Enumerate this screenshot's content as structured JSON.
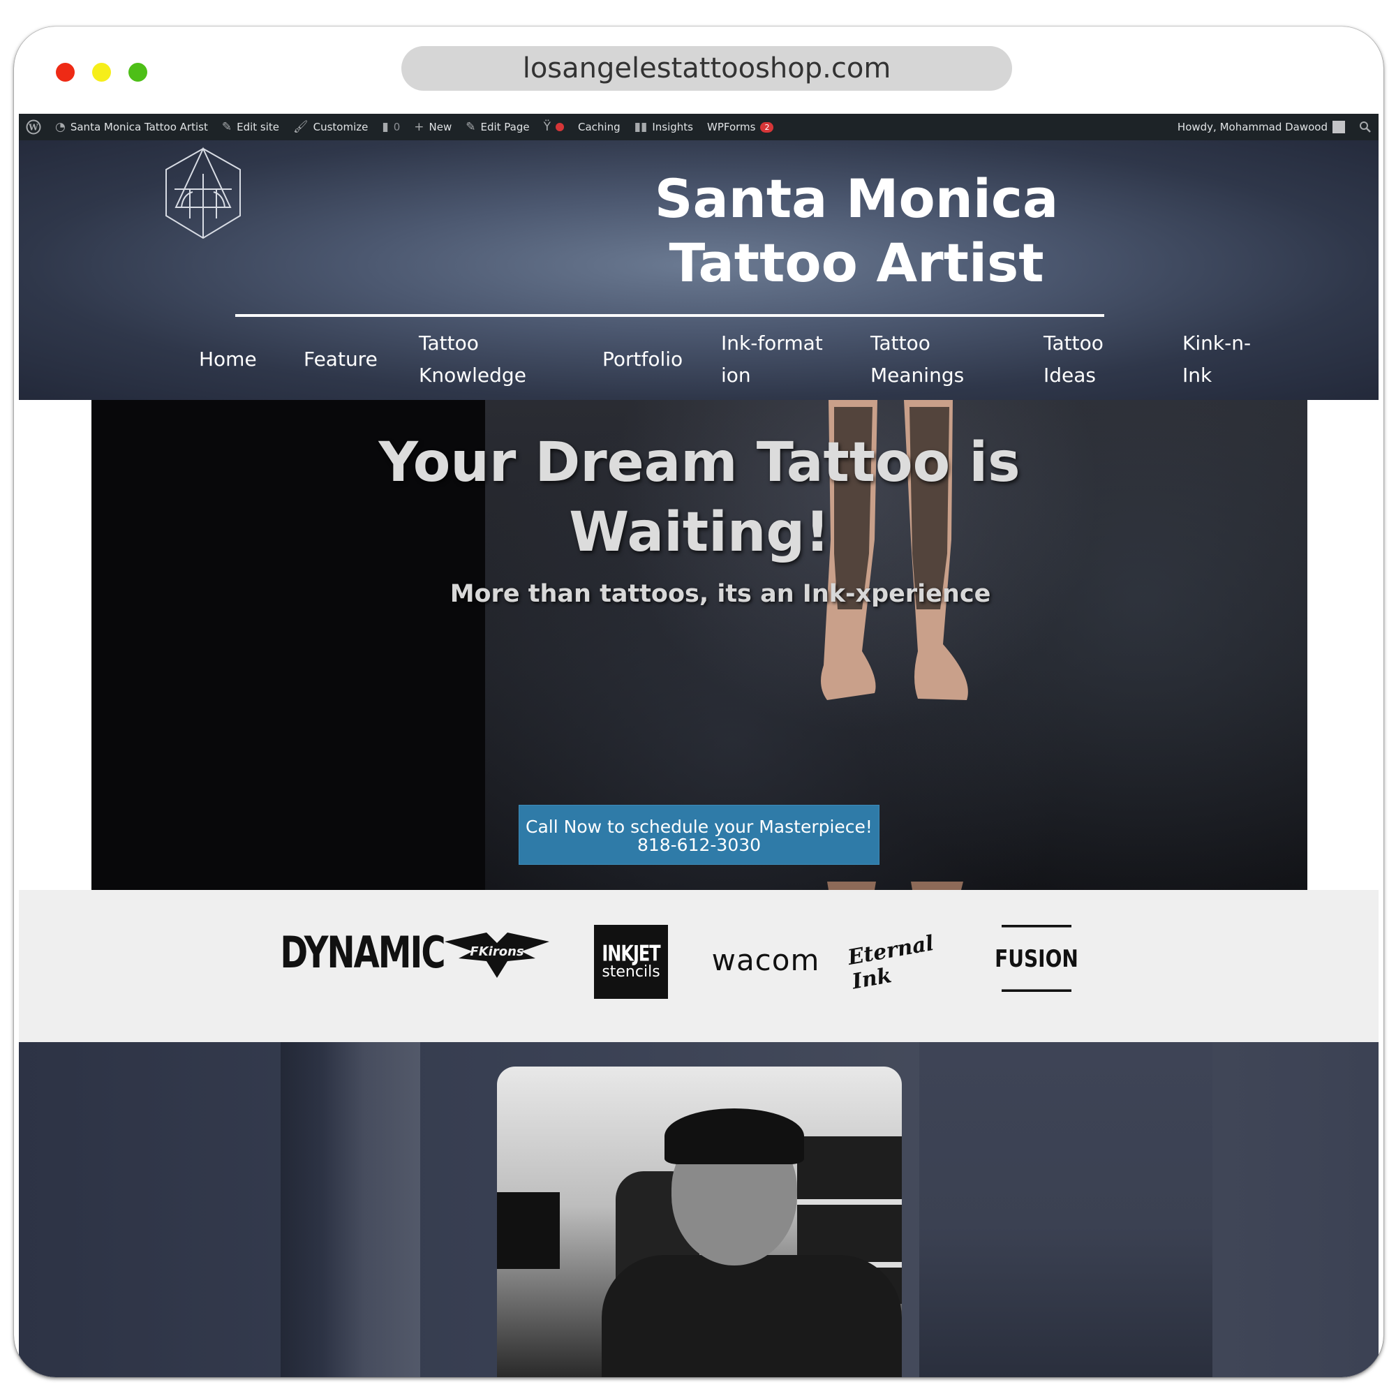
{
  "browser": {
    "url": "losangelestattooshop.com"
  },
  "adminbar": {
    "site_name": "Santa Monica Tattoo Artist",
    "edit_site": "Edit site",
    "customize": "Customize",
    "comments_count": "0",
    "new": "New",
    "edit_page": "Edit Page",
    "caching": "Caching",
    "insights": "Insights",
    "wpforms": "WPForms",
    "wpforms_badge": "2",
    "howdy": "Howdy, Mohammad Dawood"
  },
  "header": {
    "title": "Santa Monica Tattoo Artist",
    "nav": [
      {
        "label": "Home"
      },
      {
        "label": "Feature"
      },
      {
        "label": "Tattoo Knowledge"
      },
      {
        "label": "Portfolio"
      },
      {
        "label": "Ink-formation"
      },
      {
        "label": "Tattoo Meanings"
      },
      {
        "label": "Tattoo Ideas"
      },
      {
        "label": "Kink-n-Ink"
      }
    ]
  },
  "hero": {
    "title_line1": "Your Dream Tattoo is",
    "title_line2": "Waiting!",
    "subtitle": "More than tattoos, its an Ink-xperience",
    "cta_line1": "Call Now to schedule your Masterpiece!",
    "cta_line2": "818-612-3030"
  },
  "brands": {
    "dynamic": "DYNAMIC",
    "fkirons": "FKirons",
    "inkjet_top": "INKJET",
    "inkjet_bottom": "stencils",
    "wacom": "wacom",
    "eternal": "Eternal Ink",
    "fusion": "FUSION"
  },
  "colors": {
    "admin_bar": "#1d2327",
    "header_bg": "#4c5870",
    "cta_bg": "#2f7ba8",
    "brands_bg": "#efefef",
    "studio_bg": "#3a4154"
  },
  "icons": [
    "wordpress-icon",
    "dashboard-icon",
    "edit-site-icon",
    "customize-icon",
    "comment-icon",
    "plus-icon",
    "pencil-icon",
    "yoast-icon",
    "status-dot-icon",
    "insights-icon",
    "user-avatar-icon",
    "search-icon"
  ]
}
